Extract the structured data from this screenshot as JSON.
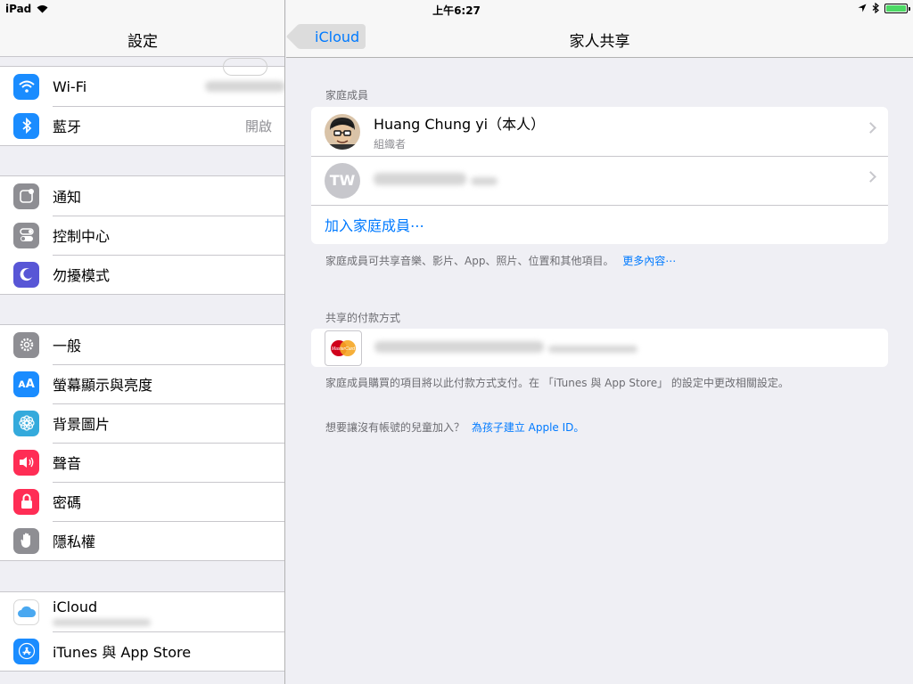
{
  "status": {
    "device": "iPad",
    "time": "上午6:27"
  },
  "left": {
    "title": "設定",
    "group1": [
      {
        "label": "Wi-Fi",
        "icon": "wifi-icon",
        "color": "#1a8cff"
      },
      {
        "label": "藍牙",
        "value": "開啟",
        "icon": "bluetooth-icon",
        "color": "#1a8cff"
      }
    ],
    "group2": [
      {
        "label": "通知",
        "icon": "notifications-icon",
        "color": "#8e8e93"
      },
      {
        "label": "控制中心",
        "icon": "control-center-icon",
        "color": "#8e8e93"
      },
      {
        "label": "勿擾模式",
        "icon": "moon-icon",
        "color": "#5856d6"
      }
    ],
    "group3": [
      {
        "label": "一般",
        "icon": "gear-icon",
        "color": "#8e8e93"
      },
      {
        "label": "螢幕顯示與亮度",
        "icon": "display-icon",
        "color": "#1a8cff"
      },
      {
        "label": "背景圖片",
        "icon": "wallpaper-icon",
        "color": "#34aadc"
      },
      {
        "label": "聲音",
        "icon": "sound-icon",
        "color": "#ff2d55"
      },
      {
        "label": "密碼",
        "icon": "lock-icon",
        "color": "#ff2d55"
      },
      {
        "label": "隱私權",
        "icon": "hand-icon",
        "color": "#8e8e93"
      }
    ],
    "group4": [
      {
        "label": "iCloud",
        "icon": "icloud-icon"
      },
      {
        "label": "iTunes 與 App Store",
        "icon": "app-store-icon"
      }
    ]
  },
  "right": {
    "back_label": "iCloud",
    "title": "家人共享",
    "members_header": "家庭成員",
    "members": [
      {
        "name": "Huang Chung yi（本人）",
        "role": "組織者"
      },
      {
        "initials": "TW"
      }
    ],
    "add_member": "加入家庭成員⋯",
    "members_footer": "家庭成員可共享音樂、影片、App、照片、位置和其他項目。",
    "more_link": "更多內容⋯",
    "payment_header": "共享的付款方式",
    "card_brand": "MasterCard",
    "payment_footer": "家庭成員購買的項目將以此付款方式支付。在 「iTunes 與 App Store」 的設定中更改相關設定。",
    "child_prompt": "想要讓沒有帳號的兒童加入？",
    "child_link": "為孩子建立 Apple ID。"
  }
}
